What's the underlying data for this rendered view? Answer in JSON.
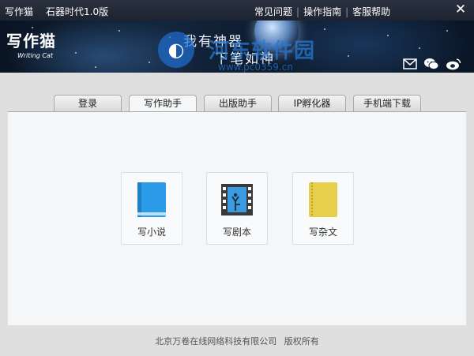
{
  "window": {
    "app_title": "写作猫",
    "version": "石器时代1.0版"
  },
  "topnav": [
    {
      "label": "常见问题"
    },
    {
      "label": "操作指南"
    },
    {
      "label": "客服帮助"
    }
  ],
  "banner": {
    "logo_text": "写作猫",
    "logo_sub": "Writing Cat",
    "slogan_line1": "我有神器",
    "slogan_line2": "下笔如神",
    "watermark_text": "河东软件园",
    "watermark_url": "www.pc0359.cn"
  },
  "social": [
    {
      "icon": "mail-icon"
    },
    {
      "icon": "wechat-icon"
    },
    {
      "icon": "weibo-icon"
    }
  ],
  "tabs": [
    {
      "label": "登录",
      "active": false
    },
    {
      "label": "写作助手",
      "active": true
    },
    {
      "label": "出版助手",
      "active": false
    },
    {
      "label": "IP孵化器",
      "active": false
    },
    {
      "label": "手机端下载",
      "active": false
    }
  ],
  "cards": [
    {
      "label": "写小说",
      "icon": "book-icon",
      "color": "#2b9be8"
    },
    {
      "label": "写剧本",
      "icon": "film-icon",
      "color": "#3a9be0"
    },
    {
      "label": "写杂文",
      "icon": "notebook-icon",
      "color": "#e6cf4a"
    }
  ],
  "footer": {
    "company": "北京万卷在线网络科技有限公司",
    "rights": "版权所有"
  }
}
